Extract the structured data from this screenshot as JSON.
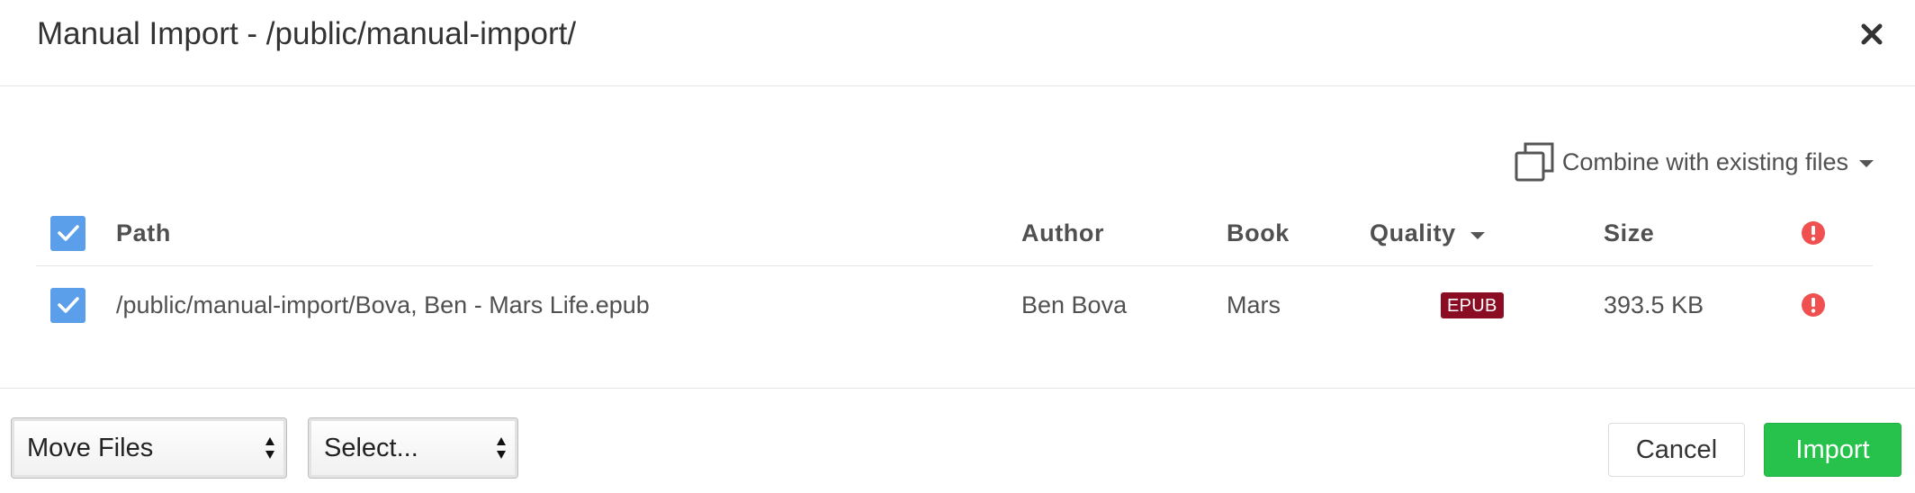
{
  "modal": {
    "title": "Manual Import - /public/manual-import/"
  },
  "combine": {
    "label": "Combine with existing files"
  },
  "table": {
    "columns": {
      "path": "Path",
      "author": "Author",
      "book": "Book",
      "quality": "Quality",
      "size": "Size"
    },
    "rows": [
      {
        "path": "/public/manual-import/Bova, Ben - Mars Life.epub",
        "author": "Ben Bova",
        "book": "Mars",
        "quality": "EPUB",
        "size": "393.5 KB",
        "checked": true
      }
    ]
  },
  "footer": {
    "move_mode": "Move Files",
    "select_placeholder": "Select...",
    "cancel_label": "Cancel",
    "import_label": "Import"
  },
  "colors": {
    "checkbox": "#5b9ee9",
    "quality_badge": "#8b0d24",
    "warning": "#f05050",
    "import_button": "#27c24c"
  },
  "icons": {
    "close": "close-icon",
    "combine": "copy-icon",
    "warning": "exclamation-circle-icon",
    "check": "check-icon"
  }
}
